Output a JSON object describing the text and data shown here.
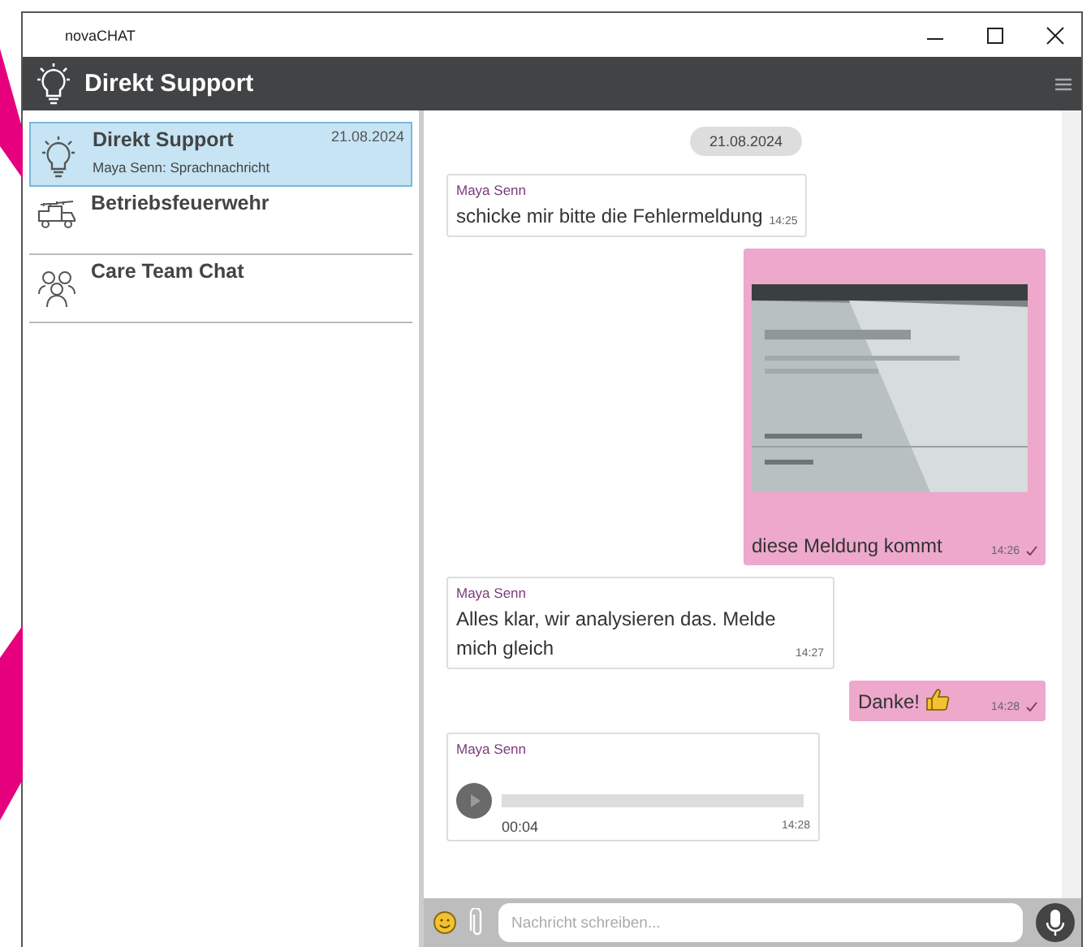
{
  "window": {
    "title": "novaCHAT"
  },
  "header": {
    "title": "Direkt Support"
  },
  "conversations": [
    {
      "name": "Direkt Support",
      "preview": "Maya Senn: Sprachnachricht",
      "date": "21.08.2024",
      "kind": "bulb",
      "selected": true
    },
    {
      "name": "Betriebsfeuerwehr",
      "kind": "truck",
      "selected": false
    },
    {
      "name": "Care Team Chat",
      "kind": "group",
      "selected": false
    }
  ],
  "date_chip": "21.08.2024",
  "messages": [
    {
      "kind": "text",
      "outgoing": false,
      "sender": "Maya Senn",
      "text": "schicke mir bitte die Fehlermeldung",
      "time": "14:25"
    },
    {
      "outgoing": true,
      "text": "diese Meldung kommt",
      "time": "14:26",
      "delivered": true
    },
    {
      "kind": "text",
      "outgoing": false,
      "sender": "Maya Senn",
      "text": "Alles klar, wir analysieren das. Melde mich gleich",
      "time": "14:27"
    },
    {
      "kind": "text",
      "outgoing": true,
      "text": "Danke!",
      "emoji": true,
      "time": "14:28",
      "delivered": true
    },
    {
      "kind": "audio",
      "outgoing": false,
      "sender": "Maya Senn",
      "duration": "00:04",
      "time": "14:28"
    }
  ],
  "composer": {
    "placeholder": "Nachricht schreiben..."
  }
}
